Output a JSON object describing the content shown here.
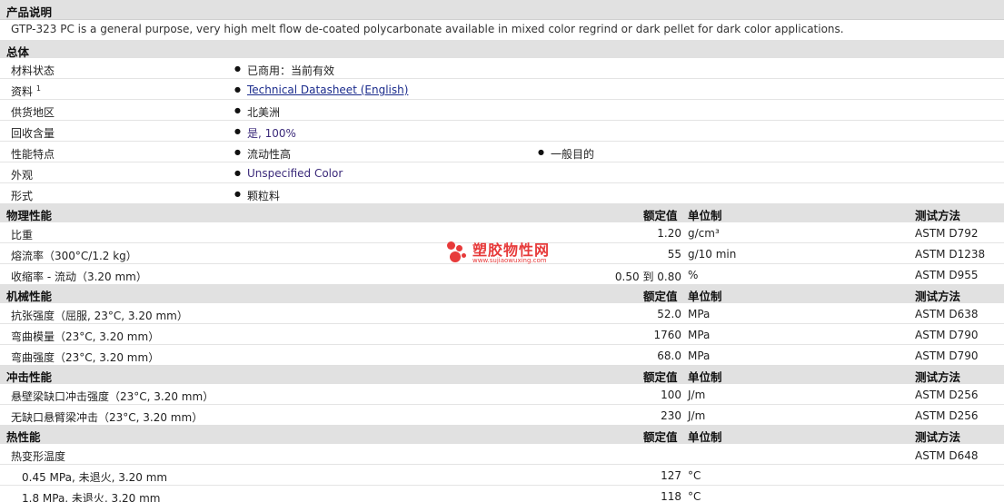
{
  "product_description": {
    "header": "产品说明",
    "text": "GTP-323 PC is a general purpose, very high melt flow de-coated polycarbonate available in mixed color regrind or dark pellet for dark color applications."
  },
  "general": {
    "header": "总体",
    "rows": [
      {
        "label": "材料状态",
        "value": "已商用：当前有效"
      },
      {
        "label": "资料",
        "sup": "1",
        "value": "Technical Datasheet (English)"
      },
      {
        "label": "供货地区",
        "value": "北美洲"
      },
      {
        "label": "回收含量",
        "value": "是, 100%"
      },
      {
        "label": "性能特点",
        "value": "流动性高",
        "value2": "一般目的"
      },
      {
        "label": "外观",
        "value": "Unspecified Color"
      },
      {
        "label": "形式",
        "value": "颗粒料"
      }
    ]
  },
  "columns": {
    "rated": "额定值",
    "unit": "单位制",
    "method": "测试方法"
  },
  "physical": {
    "header": "物理性能",
    "rows": [
      {
        "label": "比重",
        "value": "1.20",
        "unit": "g/cm³",
        "method": "ASTM D792"
      },
      {
        "label": "熔流率（300°C/1.2 kg）",
        "value": "55",
        "unit": "g/10 min",
        "method": "ASTM D1238"
      },
      {
        "label": "收缩率 - 流动（3.20 mm）",
        "value": "0.50 到  0.80",
        "unit": "%",
        "method": "ASTM D955"
      }
    ]
  },
  "mechanical": {
    "header": "机械性能",
    "rows": [
      {
        "label": "抗张强度（屈服, 23°C, 3.20 mm）",
        "value": "52.0",
        "unit": "MPa",
        "method": "ASTM D638"
      },
      {
        "label": "弯曲模量（23°C, 3.20 mm）",
        "value": "1760",
        "unit": "MPa",
        "method": "ASTM D790"
      },
      {
        "label": "弯曲强度（23°C, 3.20 mm）",
        "value": "68.0",
        "unit": "MPa",
        "method": "ASTM D790"
      }
    ]
  },
  "impact": {
    "header": "冲击性能",
    "rows": [
      {
        "label": "悬壁梁缺口冲击强度（23°C, 3.20 mm）",
        "value": "100",
        "unit": "J/m",
        "method": "ASTM D256"
      },
      {
        "label": "无缺口悬臂梁冲击（23°C, 3.20 mm）",
        "value": "230",
        "unit": "J/m",
        "method": "ASTM D256"
      }
    ]
  },
  "thermal": {
    "header": "热性能",
    "rows": [
      {
        "label": "热变形温度",
        "value": "",
        "unit": "",
        "method": "ASTM D648"
      },
      {
        "label": "0.45 MPa, 未退火, 3.20 mm",
        "value": "127",
        "unit": "°C",
        "method": ""
      },
      {
        "label": "1.8 MPa, 未退火, 3.20 mm",
        "value": "118",
        "unit": "°C",
        "method": ""
      }
    ]
  },
  "watermark": {
    "title": "塑胶物性网",
    "url": "www.sujiaowuxing.com"
  }
}
